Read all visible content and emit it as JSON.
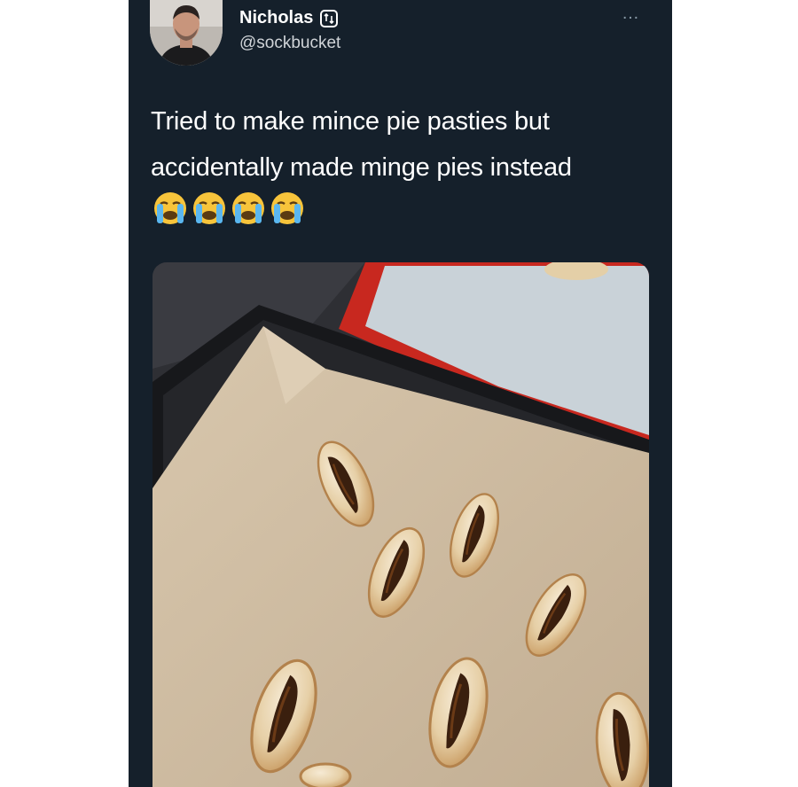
{
  "tweet": {
    "author_name": "Nicholas",
    "author_handle": "@sockbucket",
    "more_menu": "…",
    "text": "Tried to make mince pie pasties but accidentally made minge pies instead",
    "emojis": [
      "loudly-crying-face",
      "loudly-crying-face",
      "loudly-crying-face",
      "loudly-crying-face"
    ]
  },
  "photo": {
    "subject": "eight baked mince pie pasties on parchment paper in a baking tray",
    "pasty_count": 8
  },
  "colors": {
    "card_bg": "#15202b",
    "text": "#ffffff",
    "handle": "#d0d4d8",
    "more": "#8899a6",
    "page_bg": "#ffffff"
  }
}
